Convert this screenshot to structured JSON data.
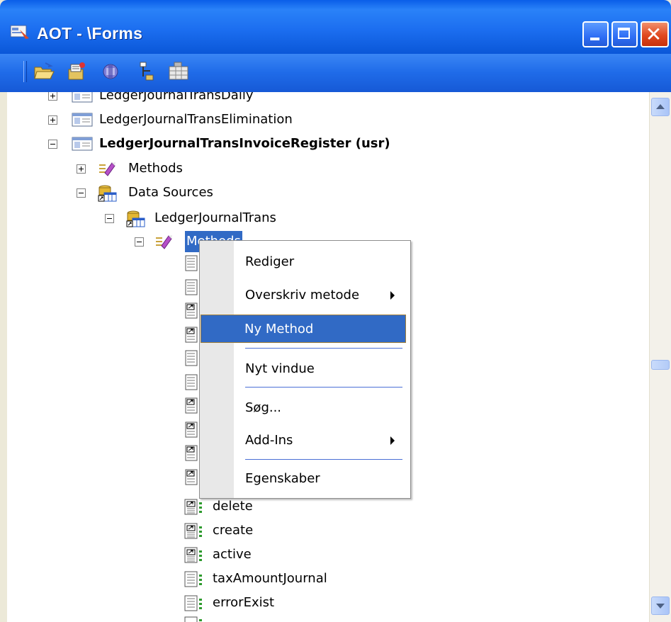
{
  "window": {
    "title": "AOT - \\Forms",
    "controls": {
      "minimize": "",
      "maximize": "",
      "close": "✕"
    }
  },
  "toolbar": {
    "tools": [
      {
        "name": "open-icon"
      },
      {
        "name": "properties-icon"
      },
      {
        "name": "compile-icon"
      },
      {
        "name": "import-icon"
      },
      {
        "name": "grid-icon"
      }
    ]
  },
  "tree": {
    "rows": [
      {
        "label": "LedgerJournalTransDaily",
        "type": "form",
        "expander": "plus"
      },
      {
        "label": "LedgerJournalTransElimination",
        "type": "form",
        "expander": "plus"
      },
      {
        "label": "LedgerJournalTransInvoiceRegister (usr)",
        "type": "form",
        "expander": "minus",
        "bold": true
      },
      {
        "label": "Methods",
        "type": "methods",
        "expander": "plus"
      },
      {
        "label": "Data Sources",
        "type": "datasources",
        "expander": "minus"
      },
      {
        "label": "LedgerJournalTrans",
        "type": "datasource",
        "expander": "minus"
      },
      {
        "label": "Methods",
        "type": "methods",
        "expander": "minus",
        "selected": true
      },
      {
        "label": "delete",
        "type": "override-method"
      },
      {
        "label": "create",
        "type": "override-method"
      },
      {
        "label": "active",
        "type": "override-method"
      },
      {
        "label": "taxAmountJournal",
        "type": "method"
      },
      {
        "label": "errorExist",
        "type": "method"
      }
    ]
  },
  "context_menu": {
    "items": [
      {
        "label": "Rediger"
      },
      {
        "label": "Overskriv metode",
        "submenu": true
      },
      {
        "label": "Ny Method",
        "highlighted": true
      },
      {
        "label": "Nyt vindue"
      },
      {
        "label": "Søg..."
      },
      {
        "label": "Add-Ins",
        "submenu": true
      },
      {
        "label": "Egenskaber"
      }
    ]
  },
  "colors": {
    "titlebar": "#0a5ee8",
    "selection": "#316ac5",
    "close_button": "#e0481f"
  }
}
